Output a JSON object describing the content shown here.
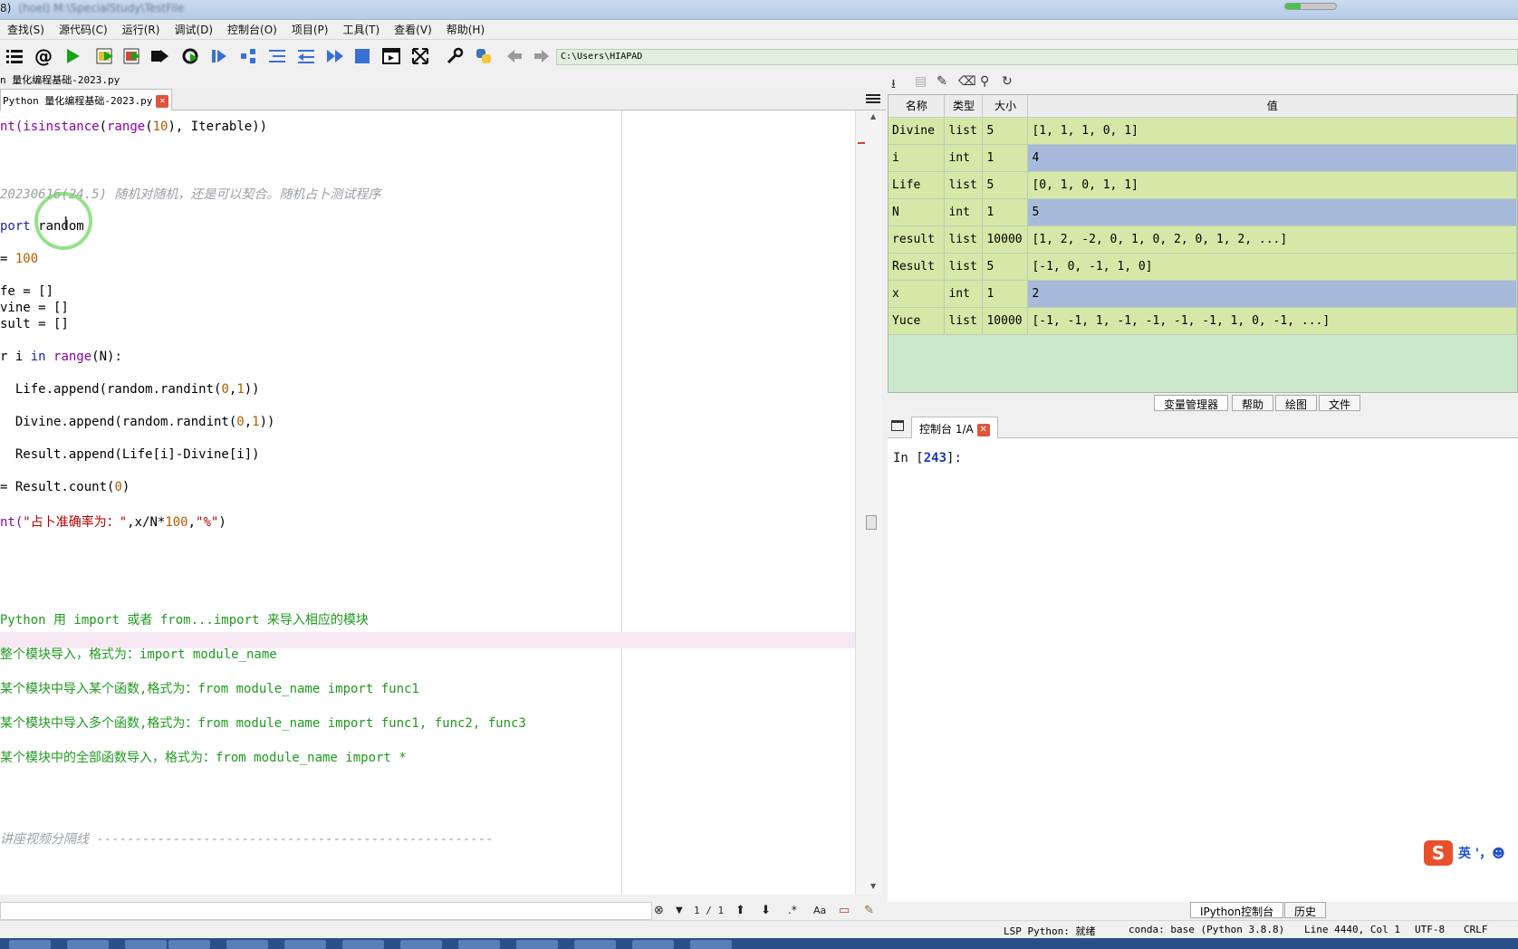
{
  "window": {
    "title": "8)",
    "title_blurred": "(hoel) M:\\SpecialStudy\\TestFile",
    "progress_fraction": 0.3
  },
  "menu": [
    "查找(S)",
    "源代码(C)",
    "运行(R)",
    "调试(D)",
    "控制台(O)",
    "项目(P)",
    "工具(T)",
    "查看(V)",
    "帮助(H)"
  ],
  "toolbar": {
    "path": "C:\\Users\\HIAPAD",
    "icons": [
      "list-icon",
      "at-icon",
      "run-icon",
      "run-cell-icon",
      "run-cell-advance-icon",
      "run-selection-icon",
      "rerun-icon",
      "debug-icon",
      "step-icon",
      "step-into-icon",
      "step-return-icon",
      "continue-icon",
      "stop-icon",
      "maximize-pane-icon",
      "fullscreen-icon",
      "wrench-icon",
      "python-path-icon",
      "back-arrow-icon",
      "forward-arrow-icon"
    ]
  },
  "editor": {
    "file_path": "n 量化编程基础-2023.py",
    "tab_label": "Python 量化编程基础-2023.py",
    "lines": [
      {
        "segments": [
          {
            "t": "nt(",
            "c": "fn"
          },
          {
            "t": "isinstance",
            "c": "fn"
          },
          {
            "t": "(",
            "c": ""
          },
          {
            "t": "range",
            "c": "fn"
          },
          {
            "t": "(",
            "c": ""
          },
          {
            "t": "10",
            "c": "num"
          },
          {
            "t": "), Iterable))",
            "c": ""
          }
        ]
      },
      {
        "segments": [
          {
            "t": "20230616(24.5) 随机对随机，还是可以契合。随机占卜测试程序",
            "c": "cm-gray"
          }
        ]
      },
      {
        "segments": [
          {
            "t": "port",
            "c": "kw"
          },
          {
            "t": " random",
            "c": ""
          }
        ]
      },
      {
        "segments": [
          {
            "t": "= ",
            "c": ""
          },
          {
            "t": "100",
            "c": "num"
          }
        ]
      },
      {
        "segments": [
          {
            "t": "fe = []",
            "c": ""
          }
        ]
      },
      {
        "segments": [
          {
            "t": "vine = []",
            "c": ""
          }
        ]
      },
      {
        "segments": [
          {
            "t": "sult = []",
            "c": ""
          }
        ]
      },
      {
        "segments": [
          {
            "t": "r i ",
            "c": ""
          },
          {
            "t": "in",
            "c": "kw"
          },
          {
            "t": " ",
            "c": ""
          },
          {
            "t": "range",
            "c": "fn"
          },
          {
            "t": "(N):",
            "c": ""
          }
        ]
      },
      {
        "segments": [
          {
            "t": "  Life.append(random.randint(",
            "c": ""
          },
          {
            "t": "0",
            "c": "num"
          },
          {
            "t": ",",
            "c": ""
          },
          {
            "t": "1",
            "c": "num"
          },
          {
            "t": "))",
            "c": ""
          }
        ]
      },
      {
        "segments": [
          {
            "t": "  Divine.append(random.randint(",
            "c": ""
          },
          {
            "t": "0",
            "c": "num"
          },
          {
            "t": ",",
            "c": ""
          },
          {
            "t": "1",
            "c": "num"
          },
          {
            "t": "))",
            "c": ""
          }
        ]
      },
      {
        "segments": [
          {
            "t": "  Result.append(Life[i]-Divine[i])",
            "c": ""
          }
        ]
      },
      {
        "segments": [
          {
            "t": "= Result.count(",
            "c": ""
          },
          {
            "t": "0",
            "c": "num"
          },
          {
            "t": ")",
            "c": ""
          }
        ]
      },
      {
        "segments": [
          {
            "t": "nt(",
            "c": "fn"
          },
          {
            "t": "\"占卜准确率为：\"",
            "c": "str"
          },
          {
            "t": ",x/N*",
            "c": ""
          },
          {
            "t": "100",
            "c": "num"
          },
          {
            "t": ",",
            "c": ""
          },
          {
            "t": "\"%\"",
            "c": "str"
          },
          {
            "t": ")",
            "c": ""
          }
        ]
      },
      {
        "segments": [
          {
            "t": "Python 用 import 或者 from...import 来导入相应的模块",
            "c": "cm-green"
          }
        ]
      },
      {
        "segments": [
          {
            "t": "整个模块导入，格式为：import module_name",
            "c": "cm-green"
          }
        ]
      },
      {
        "segments": [
          {
            "t": "某个模块中导入某个函数,格式为：from module_name import func1",
            "c": "cm-green"
          }
        ]
      },
      {
        "segments": [
          {
            "t": "某个模块中导入多个函数,格式为：from module_name import func1, func2, func3",
            "c": "cm-green"
          }
        ]
      },
      {
        "segments": [
          {
            "t": "某个模块中的全部函数导入，格式为：from module_name import *",
            "c": "cm-green"
          }
        ]
      },
      {
        "segments": [
          {
            "t": "讲座视频分隔线 ----------------------------------------------------",
            "c": "cm-gray"
          }
        ]
      }
    ]
  },
  "findbar": {
    "count": "1 / 1",
    "case_label": "Aa"
  },
  "variable_explorer": {
    "headers": [
      "名称",
      "类型",
      "大小",
      "值"
    ],
    "rows": [
      {
        "name": "Divine",
        "type": "list",
        "size": "5",
        "value": "[1, 1, 1, 0, 1]"
      },
      {
        "name": "i",
        "type": "int",
        "size": "1",
        "value": "4"
      },
      {
        "name": "Life",
        "type": "list",
        "size": "5",
        "value": "[0, 1, 0, 1, 1]"
      },
      {
        "name": "N",
        "type": "int",
        "size": "1",
        "value": "5"
      },
      {
        "name": "result",
        "type": "list",
        "size": "10000",
        "value": "[1, 2, -2, 0, 1, 0, 2, 0, 1, 2, ...]"
      },
      {
        "name": "Result",
        "type": "list",
        "size": "5",
        "value": "[-1, 0, -1, 1, 0]"
      },
      {
        "name": "x",
        "type": "int",
        "size": "1",
        "value": "2"
      },
      {
        "name": "Yuce",
        "type": "list",
        "size": "10000",
        "value": "[-1, -1, 1, -1, -1, -1, -1, 1, 0, -1, ...]"
      }
    ],
    "tabs": [
      "变量管理器",
      "帮助",
      "绘图",
      "文件"
    ]
  },
  "console": {
    "tab_label": "控制台 1/A",
    "prompt_prefix": "In [",
    "prompt_number": "243",
    "prompt_suffix": "]:",
    "ime_label": "英 '，☻",
    "bottom_tabs": [
      "IPython控制台",
      "历史"
    ]
  },
  "statusbar": {
    "lsp": "LSP Python: 就绪",
    "conda": "conda: base (Python 3.8.8)",
    "position": "Line 4440, Col 1",
    "encoding": "UTF-8",
    "eol": "CRLF"
  }
}
